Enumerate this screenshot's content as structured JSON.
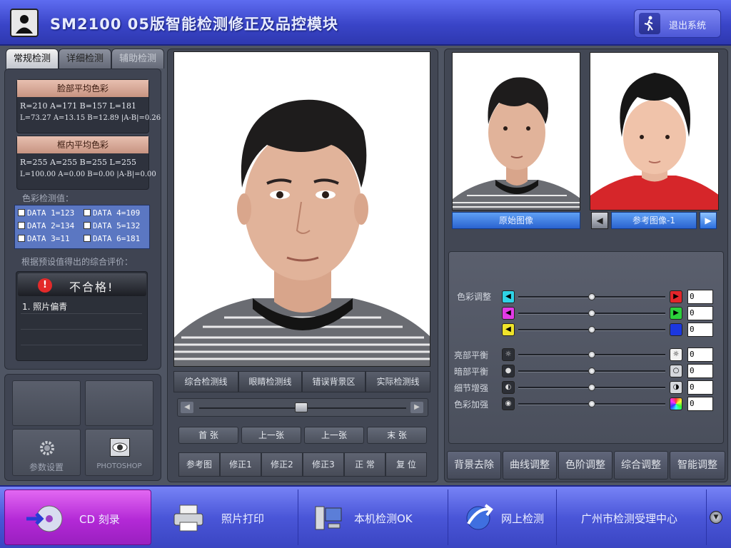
{
  "title_bar": {
    "app_title": "SM2100 05版智能检测修正及品控模块",
    "exit_label": "退出系统"
  },
  "left_tabs": [
    "常规检测",
    "详细检测",
    "辅助检测"
  ],
  "face_avg": {
    "header": "脸部平均色彩",
    "line1": "R=210   A=171   B=157   L=181",
    "line2": "L=73.27  A=13.15  B=12.89  |A-B|=0.26"
  },
  "frame_avg": {
    "header": "框内平均色彩",
    "line1": "R=255   A=255   B=255   L=255",
    "line2": "L=100.00  A=0.00   B=0.00   |A-B|=0.00"
  },
  "color_detect_label": "色彩检测值：",
  "data_items": [
    "DATA 1=123",
    "DATA 4=109",
    "DATA 2=134",
    "DATA 5=132",
    "DATA 3=11",
    "DATA 6=181"
  ],
  "eval_label": "根据预设值得出的综合评价：",
  "result": {
    "status": "不合格!",
    "items": [
      "1. 照片偏青"
    ]
  },
  "left_buttons": {
    "settings_label": "参数设置",
    "photoshop_label": "PHOTOSHOP"
  },
  "detect_tabs": [
    "综合检测线",
    "眼睛检测线",
    "错误背景区",
    "实际检测线"
  ],
  "nav_buttons": [
    "首  张",
    "上一张",
    "上一张",
    "末  张"
  ],
  "fix_buttons": [
    "参考图",
    "修正1",
    "修正2",
    "修正3",
    "正  常",
    "复  位"
  ],
  "thumbs": {
    "original_label": "原始图像",
    "reference_label": "参考图像-1"
  },
  "sliders": {
    "color_adjust_label": "色彩调整",
    "highlight_label": "亮部平衡",
    "shadow_label": "暗部平衡",
    "detail_label": "细节增强",
    "color_boost_label": "色彩加强",
    "values": [
      "0",
      "0",
      "0",
      "0",
      "0",
      "0",
      "0"
    ]
  },
  "right_buttons": [
    "背景去除",
    "曲线调整",
    "色阶调整",
    "综合调整",
    "智能调整"
  ],
  "bottom_bar": [
    "CD 刻录",
    "照片打印",
    "本机检测OK",
    "网上检测",
    "广州市检测受理中心"
  ],
  "colors": {
    "accent_blue": "#3a45c8",
    "active_purple": "#b329d6",
    "alert_red": "#e32a2a"
  }
}
